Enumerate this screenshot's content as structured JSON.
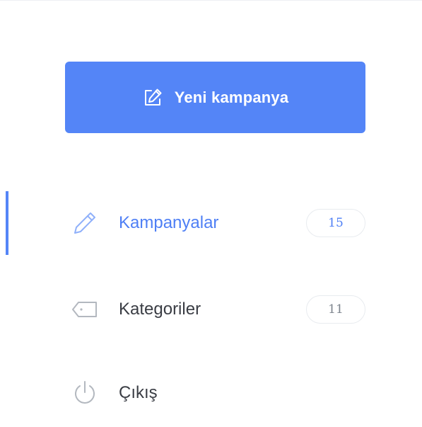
{
  "new_campaign_button": {
    "label": "Yeni kampanya",
    "icon": "edit-icon"
  },
  "nav": {
    "items": [
      {
        "label": "Kampanyalar",
        "count": "15",
        "icon": "pencil-icon",
        "active": true
      },
      {
        "label": "Kategoriler",
        "count": "11",
        "icon": "tag-icon",
        "active": false
      },
      {
        "label": "Çıkış",
        "icon": "power-icon",
        "active": false
      }
    ]
  },
  "colors": {
    "accent": "#5485f7",
    "active_text": "#4e7ff5",
    "text": "#3a3d44",
    "muted": "#7d848d",
    "icon_muted": "#b3b8bf",
    "badge_border": "#e8ebef"
  }
}
